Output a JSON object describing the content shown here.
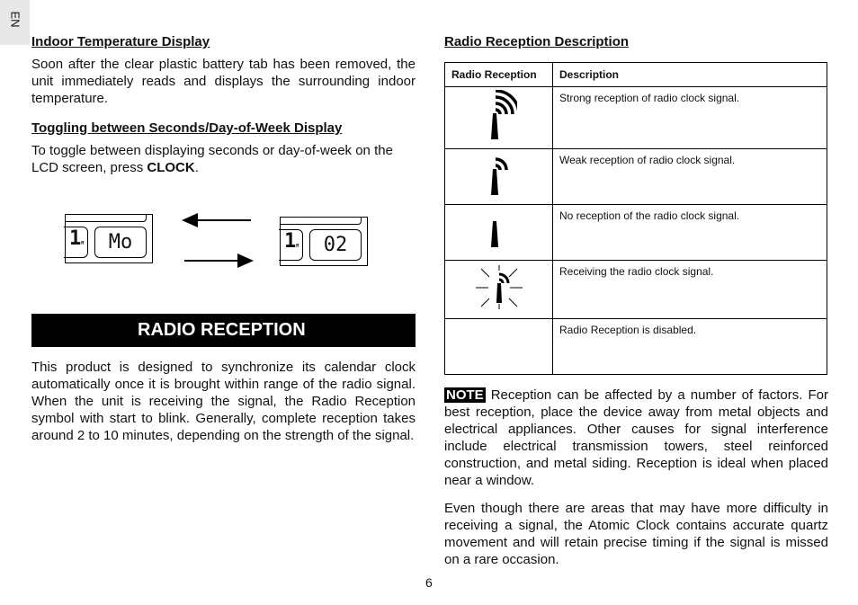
{
  "lang_tab": "EN",
  "left": {
    "s1_title": "Indoor Temperature Display",
    "s1_text": "Soon after the clear plastic battery tab has been removed, the unit immediately reads and displays the surrounding indoor temperature.",
    "s2_title": "Toggling between Seconds/Day-of-Week Display",
    "s2_text": "To toggle between displaying seconds or day-of-week on the LCD screen, press ",
    "s2_bold": "CLOCK",
    "s2_end": ".",
    "lcd1": {
      "small": "1",
      "unit": "M",
      "main": "Mo"
    },
    "lcd2": {
      "small": "1",
      "unit": "M",
      "main": "02"
    },
    "banner": "RADIO RECEPTION",
    "s3_text": "This product is designed to synchronize its calendar clock automatically once it is brought within range of the radio signal. When the unit is receiving the signal, the Radio Reception symbol with start to blink. Generally, complete reception takes around 2 to 10 minutes, depending on the strength of the signal."
  },
  "right": {
    "title": "Radio Reception Description",
    "headers": [
      "Radio Reception",
      "Description"
    ],
    "rows": [
      {
        "icon": "antenna-strong-icon",
        "desc": "Strong reception of radio clock signal."
      },
      {
        "icon": "antenna-weak-icon",
        "desc": "Weak reception of radio clock signal."
      },
      {
        "icon": "antenna-none-icon",
        "desc": "No reception of the radio clock signal."
      },
      {
        "icon": "antenna-blinking-icon",
        "desc": "Receiving the radio clock signal."
      },
      {
        "icon": "",
        "desc": "Radio Reception is disabled."
      }
    ],
    "note_label": "NOTE",
    "note_text": " Reception can be affected by a number of factors. For best reception, place the device away from metal objects and electrical appliances. Other causes for signal interference include electrical transmission towers, steel reinforced construction, and metal siding. Reception is ideal when placed near a window.",
    "p2": "Even though there are areas that may have more difficulty in receiving a signal, the Atomic Clock contains accurate quartz movement and will retain precise timing if the signal is missed on a rare occasion."
  },
  "page_number": "6"
}
